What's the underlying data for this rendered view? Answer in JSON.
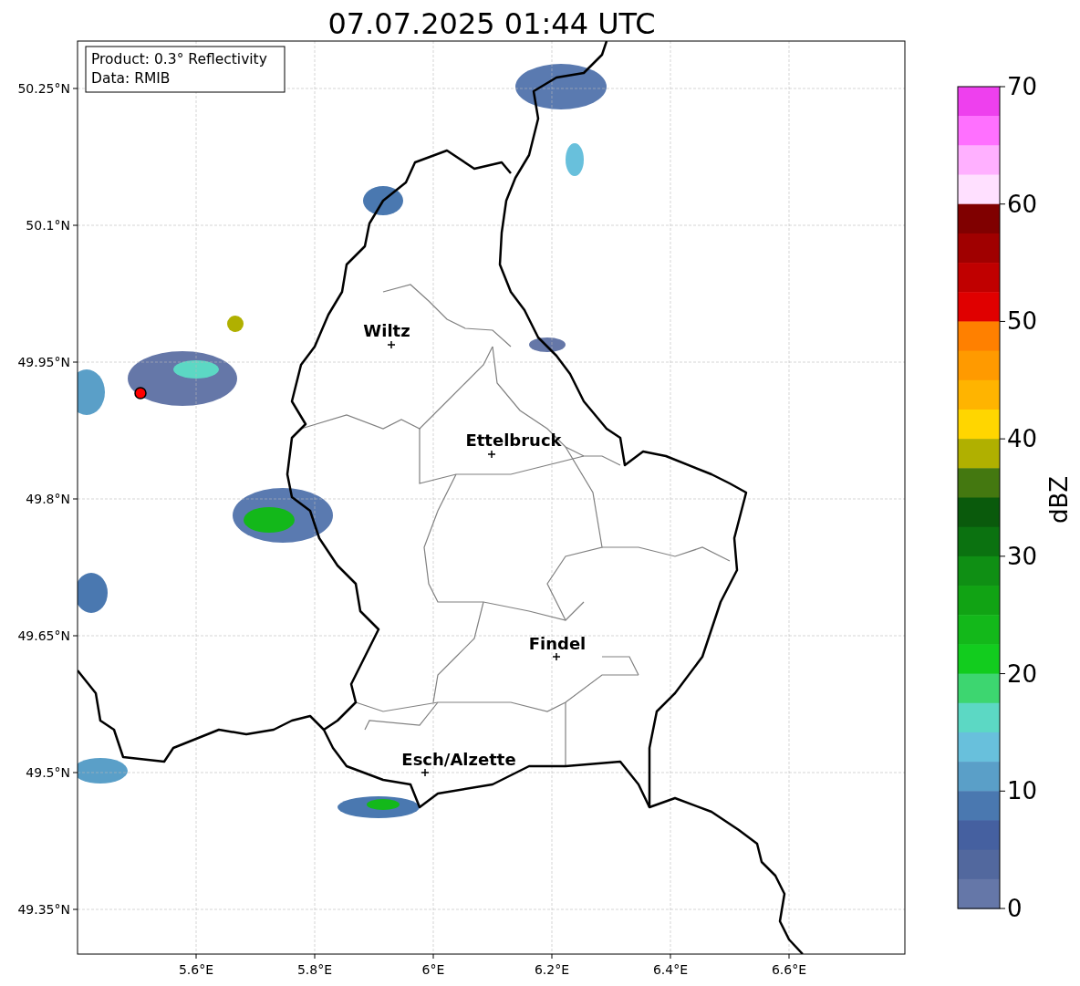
{
  "title": "07.07.2025 01:44 UTC",
  "info_box": [
    "Product: 0.3° Reflectivity",
    "Data: RMIB"
  ],
  "y_ticks": [
    "50.25°N",
    "50.1°N",
    "49.95°N",
    "49.8°N",
    "49.65°N",
    "49.5°N",
    "49.35°N"
  ],
  "x_ticks": [
    "5.6°E",
    "5.8°E",
    "6°E",
    "6.2°E",
    "6.4°E",
    "6.6°E"
  ],
  "cities": [
    {
      "name": "Wiltz"
    },
    {
      "name": "Ettelbruck"
    },
    {
      "name": "Findel"
    },
    {
      "name": "Esch/Alzette"
    }
  ],
  "colorbar": {
    "label": "dBZ",
    "ticks": [
      "70",
      "60",
      "50",
      "40",
      "30",
      "20",
      "10",
      "0"
    ],
    "bins": [
      {
        "color": "#ee40ee"
      },
      {
        "color": "#ff70ff"
      },
      {
        "color": "#ffb0ff"
      },
      {
        "color": "#ffe0ff"
      },
      {
        "color": "#800000"
      },
      {
        "color": "#a00000"
      },
      {
        "color": "#c00000"
      },
      {
        "color": "#e00000"
      },
      {
        "color": "#ff8000"
      },
      {
        "color": "#ff9a00"
      },
      {
        "color": "#ffb400"
      },
      {
        "color": "#ffd600"
      },
      {
        "color": "#b0b000"
      },
      {
        "color": "#447810"
      },
      {
        "color": "#0a5a0c"
      },
      {
        "color": "#0b7210"
      },
      {
        "color": "#0f8f14"
      },
      {
        "color": "#11a314"
      },
      {
        "color": "#13b81a"
      },
      {
        "color": "#12cc1e"
      },
      {
        "color": "#3dd670"
      },
      {
        "color": "#5cd8c4"
      },
      {
        "color": "#68c0dc"
      },
      {
        "color": "#5a9fc8"
      },
      {
        "color": "#4a78b0"
      },
      {
        "color": "#4560a0"
      },
      {
        "color": "#52689e"
      },
      {
        "color": "#6577a8"
      }
    ]
  }
}
